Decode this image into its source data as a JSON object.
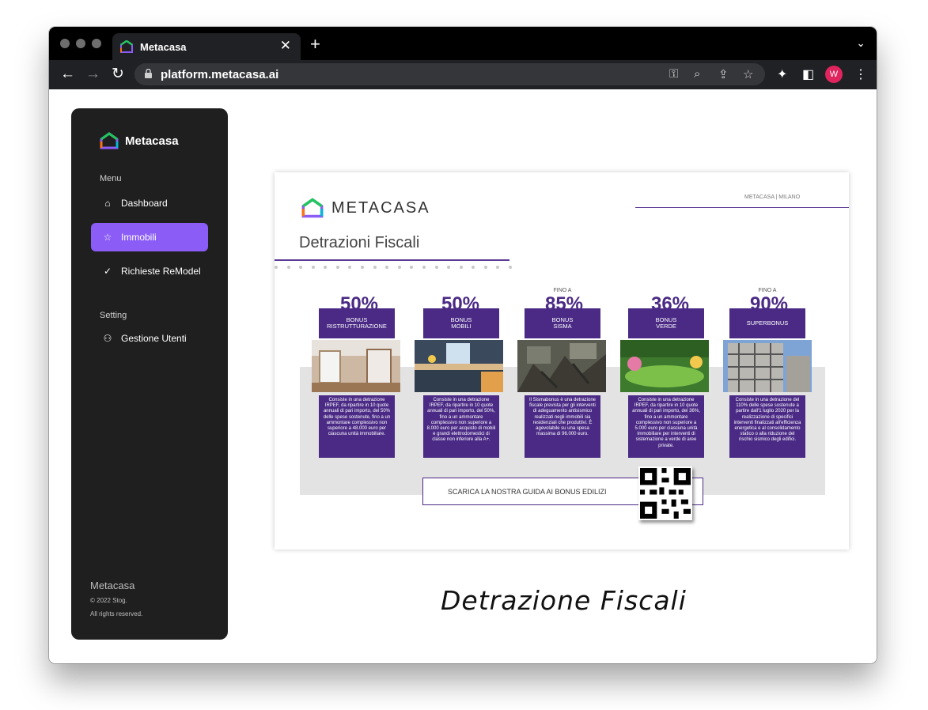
{
  "browser": {
    "tab_title": "Metacasa",
    "url": "platform.metacasa.ai",
    "avatar_initial": "W"
  },
  "sidebar": {
    "brand": "Metacasa",
    "menu_label": "Menu",
    "items": [
      {
        "label": "Dashboard",
        "icon": "home-icon"
      },
      {
        "label": "Immobili",
        "icon": "star-icon",
        "active": true
      },
      {
        "label": "Richieste ReModel",
        "icon": "check-circle-icon"
      }
    ],
    "setting_label": "Setting",
    "setting_items": [
      {
        "label": "Gestione Utenti",
        "icon": "users-icon"
      }
    ],
    "footer": {
      "name": "Metacasa",
      "copyright": "© 2022 Stog.",
      "rights": "All rights reserved."
    }
  },
  "document": {
    "brand": "METACASA",
    "location": "METACASA | MILANO",
    "title": "Detrazioni Fiscali",
    "bonuses": [
      {
        "pre": "",
        "percent": "50%",
        "label": "BONUS\nRISTRUTTURAZIONE",
        "desc": "Consiste in una detrazione IRPEF, da ripartire in 10 quote annuali di pari importo, del 50% delle spese sostenute, fino a un ammontare complessivo non superiore a 48.000 euro per ciascuna unità immobiliare."
      },
      {
        "pre": "",
        "percent": "50%",
        "label": "BONUS\nMOBILI",
        "desc": "Consiste in una detrazione IRPEF, da ripartire in 10 quote annuali di pari importo, del 50%, fino a un ammontare complessivo non superiore a 8.000 euro per acquisto di mobili e grandi elettrodomestici di classe non inferiore alla A+."
      },
      {
        "pre": "FINO A",
        "percent": "85%",
        "label": "BONUS\nSISMA",
        "desc": "Il Sismabonus è una detrazione fiscale prevista per gli interventi di adeguamento antisismico realizzati negli immobili sia residenziali che produttivi. È agevolabile su una spesa massima di 96.000 euro."
      },
      {
        "pre": "",
        "percent": "36%",
        "label": "BONUS\nVERDE",
        "desc": "Consiste in una detrazione IRPEF, da ripartire in 10 quote annuali di pari importo, del 36%, fino a un ammontare complessivo non superiore a 5.000 euro per ciascuna unità immobiliare per interventi di sistemazione a verde di aree private."
      },
      {
        "pre": "FINO A",
        "percent": "90%",
        "label": "SUPERBONUS",
        "desc": "Consiste in una detrazione del 110% delle spese sostenute a partire dall'1 luglio 2020 per la realizzazione di specifici interventi finalizzati all'efficienza energetica e al consolidamento statico o alla riduzione del rischio sismico degli edifici."
      }
    ],
    "guide_cta": "SCARICA LA NOSTRA GUIDA AI BONUS EDILIZI"
  },
  "caption": "Detrazione Fiscali"
}
